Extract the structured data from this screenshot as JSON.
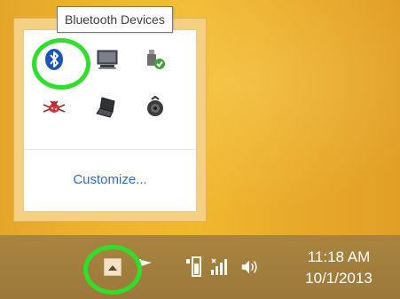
{
  "tooltip": {
    "text": "Bluetooth Devices"
  },
  "overflow_panel": {
    "icons": [
      {
        "name": "bluetooth-icon",
        "row": 0,
        "col": 0
      },
      {
        "name": "display-icon",
        "row": 0,
        "col": 1
      },
      {
        "name": "safely-remove-hardware-icon",
        "row": 0,
        "col": 2
      },
      {
        "name": "bug-icon",
        "row": 1,
        "col": 0
      },
      {
        "name": "laptop-icon",
        "row": 1,
        "col": 1
      },
      {
        "name": "media-disc-icon",
        "row": 1,
        "col": 2
      }
    ],
    "customize_label": "Customize..."
  },
  "taskbar": {
    "icons": [
      "show-hidden-icons-button",
      "action-center-flag-icon",
      "power-icon",
      "network-icon",
      "volume-icon"
    ],
    "clock": {
      "time": "11:18 AM",
      "date": "10/1/2013"
    }
  },
  "colors": {
    "highlight": "#2ee02a",
    "wallpaper": "#efb52e",
    "taskbar": "#a3803e",
    "link": "#2e6cc4"
  }
}
